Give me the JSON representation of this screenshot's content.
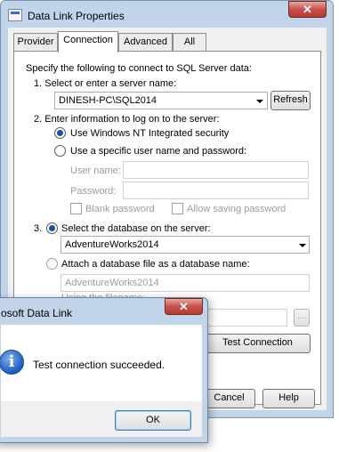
{
  "window": {
    "title": "Data Link Properties",
    "close_glyph": "✕"
  },
  "tabs": [
    "Provider",
    "Connection",
    "Advanced",
    "All"
  ],
  "connection": {
    "intro": "Specify the following to connect to SQL Server data:",
    "step1_label": "1. Select or enter a server name:",
    "server_value": "DINESH-PC\\SQL2014",
    "refresh_label": "Refresh",
    "step2_label": "2. Enter information to log on to the server:",
    "radio_windows": "Use Windows NT Integrated security",
    "radio_specific": "Use a specific user name and password:",
    "username_label": "User name:",
    "username_value": "",
    "password_label": "Password:",
    "password_value": "",
    "blank_password": "Blank password",
    "allow_saving": "Allow saving password",
    "step3_prefix": "3.",
    "radio_select_db": "Select the database on the server:",
    "database_value": "AdventureWorks2014",
    "radio_attach": "Attach a database file as a database name:",
    "attach_value": "AdventureWorks2014",
    "partial_label": "Using the filename:",
    "browse_label": "...",
    "test_connection": "Test Connection"
  },
  "buttons": {
    "cancel": "Cancel",
    "help": "Help"
  },
  "dialog": {
    "title": "osoft Data Link",
    "message": "Test connection succeeded.",
    "ok": "OK",
    "icon_glyph": "i",
    "close_glyph": "✕"
  }
}
